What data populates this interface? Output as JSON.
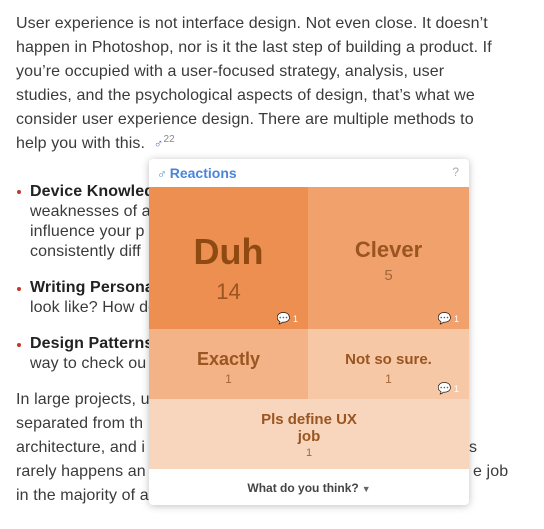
{
  "article": {
    "intro_lines": [
      "User experience is not interface design. Not even close. It doesn’t",
      "happen in Photoshop, nor is it the last step of building a product. If",
      "you’re occupied with a user-focused strategy, analysis, user",
      "studies, and the psychological aspects of design, that’s what we",
      "consider user experience design. There are multiple methods to",
      "help you with this."
    ],
    "reaction_count": "22",
    "bullets": [
      {
        "title": "Device Knowled",
        "lines": [
          "weaknesses of a",
          "influence your p",
          "consistently diff"
        ]
      },
      {
        "title": "Writing Persona",
        "lines": [
          "look like? How do"
        ]
      },
      {
        "title": "Design Patterns",
        "lines": [
          "way to check ou"
        ]
      }
    ],
    "outro_left": [
      "In large projects, u",
      "separated from th",
      "architecture, and i",
      "rarely happens an",
      "in the majority of a"
    ],
    "outro_right": [
      "s",
      "e job"
    ]
  },
  "popup": {
    "title": "Reactions",
    "help": "?",
    "tiles": {
      "duh": {
        "label": "Duh",
        "count": "14",
        "comments": "1"
      },
      "clever": {
        "label": "Clever",
        "count": "5",
        "comments": "1"
      },
      "exactly": {
        "label": "Exactly",
        "count": "1"
      },
      "notsure": {
        "label": "Not so sure.",
        "count": "1",
        "comments": "1"
      },
      "define": {
        "label_line1": "Pls define UX",
        "label_line2": "job",
        "count": "1"
      }
    },
    "footer": {
      "label": "What do you think?"
    }
  },
  "colors": {
    "accent": "#4a86d8",
    "bullet": "#c0392b",
    "duh": "#ec8f50",
    "clever": "#f1a26c",
    "exactly": "#f3b387",
    "notsure": "#f6c8a6",
    "define": "#f8d6bd"
  }
}
